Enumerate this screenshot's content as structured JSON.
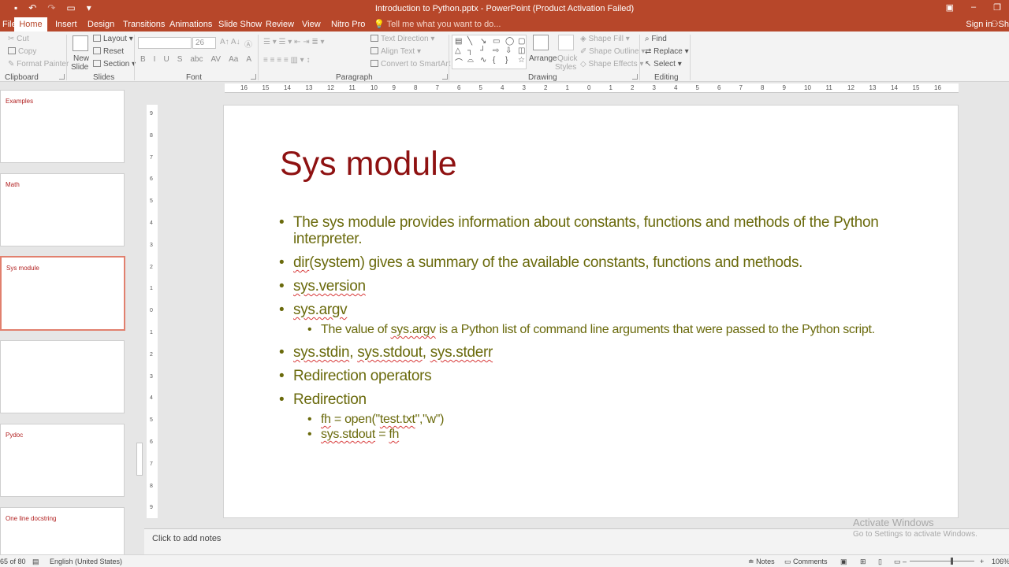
{
  "window": {
    "title": "Introduction to Python.pptx - PowerPoint (Product Activation Failed)",
    "sign_in": "Sign in",
    "share": "Sh"
  },
  "tabs": [
    "File",
    "Home",
    "Insert",
    "Design",
    "Transitions",
    "Animations",
    "Slide Show",
    "Review",
    "View",
    "Nitro Pro"
  ],
  "active_tab": "Home",
  "tell_me": "Tell me what you want to do...",
  "ribbon": {
    "clipboard": {
      "label": "Clipboard",
      "cut": "Cut",
      "copy": "Copy",
      "format_painter": "Format Painter"
    },
    "slides": {
      "label": "Slides",
      "new_slide_1": "New",
      "new_slide_2": "Slide",
      "layout": "Layout",
      "reset": "Reset",
      "section": "Section"
    },
    "font": {
      "label": "Font",
      "size": "26"
    },
    "paragraph": {
      "label": "Paragraph",
      "text_direction": "Text Direction",
      "align_text": "Align Text",
      "convert_smartart": "Convert to SmartArt"
    },
    "drawing": {
      "label": "Drawing",
      "arrange": "Arrange",
      "quick_styles_1": "Quick",
      "quick_styles_2": "Styles",
      "shape_fill": "Shape Fill",
      "shape_outline": "Shape Outline",
      "shape_effects": "Shape Effects"
    },
    "editing": {
      "label": "Editing",
      "find": "Find",
      "replace": "Replace",
      "select": "Select"
    }
  },
  "thumbnails": [
    {
      "title": "Examples",
      "selected": false
    },
    {
      "title": "Math",
      "selected": false
    },
    {
      "title": "Sys module",
      "selected": true
    },
    {
      "title": "",
      "selected": false
    },
    {
      "title": "Pydoc",
      "selected": false
    },
    {
      "title": "One line docstring",
      "selected": false
    }
  ],
  "ruler_h": [
    "16",
    "15",
    "14",
    "13",
    "12",
    "11",
    "10",
    "9",
    "8",
    "7",
    "6",
    "5",
    "4",
    "3",
    "2",
    "1",
    "0",
    "1",
    "2",
    "3",
    "4",
    "5",
    "6",
    "7",
    "8",
    "9",
    "10",
    "11",
    "12",
    "13",
    "14",
    "15",
    "16"
  ],
  "ruler_v": [
    "9",
    "8",
    "7",
    "6",
    "5",
    "4",
    "3",
    "2",
    "1",
    "0",
    "1",
    "2",
    "3",
    "4",
    "5",
    "6",
    "7",
    "8",
    "9"
  ],
  "slide": {
    "title": "Sys module",
    "b1": "The sys module provides information about constants, functions and methods of the Python interpreter.",
    "b2_sq": "dir",
    "b2_rest": "(system) gives a summary of the available constants, functions and methods.",
    "b3": "sys.version",
    "b4": "sys.argv",
    "b4_sub_pre": "The value of ",
    "b4_sub_sq": "sys.argv",
    "b4_sub_post": " is a Python list of command line arguments that were passed to the Python script.",
    "b5_a": "sys.stdin",
    "b5_sep1": ", ",
    "b5_b": "sys.stdout",
    "b5_sep2": ", ",
    "b5_c": "sys.stderr",
    "b6": "Redirection operators",
    "b7": "Redirection",
    "b7_sub1_sq": "fh",
    "b7_sub1_mid": " = open(\"",
    "b7_sub1_file": "test.txt",
    "b7_sub1_end": "\",\"w\")",
    "b7_sub2_a": "sys.stdout",
    "b7_sub2_mid": " = ",
    "b7_sub2_b": "fh"
  },
  "notes_placeholder": "Click to add notes",
  "watermark": {
    "line1": "Activate Windows",
    "line2": "Go to Settings to activate Windows."
  },
  "status": {
    "slide_count": "65 of 80",
    "language": "English (United States)",
    "notes": "Notes",
    "comments": "Comments",
    "zoom": "106%"
  },
  "colors": {
    "accent": "#b7472a",
    "slide_title": "#8e1111",
    "body_text": "#6a6a0c"
  }
}
